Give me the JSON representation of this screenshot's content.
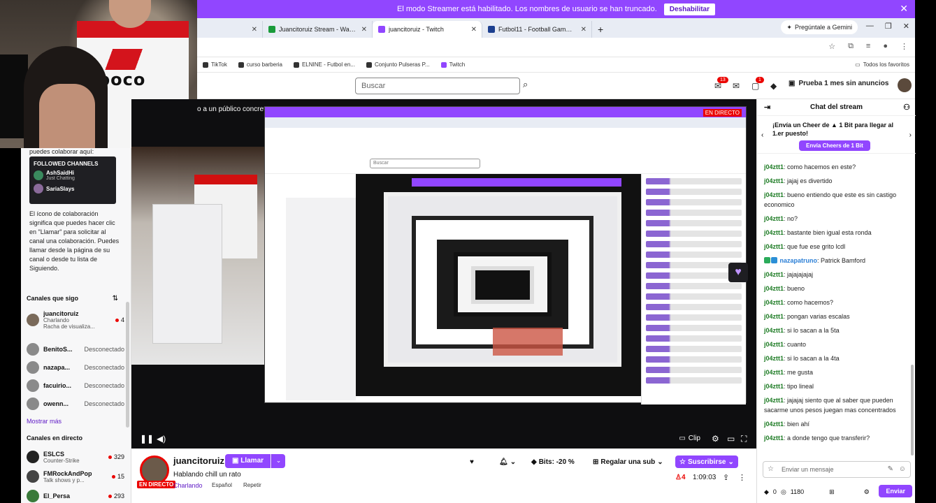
{
  "streamer_bar": {
    "message": "El modo Streamer está habilitado. Los nombres de usuario se han truncado.",
    "button": "Deshabilitar"
  },
  "tabs": [
    {
      "title": "Juancitoruiz Stream - Watch Li...",
      "color": "#1a9b3a"
    },
    {
      "title": "juancitoruiz - Twitch",
      "color": "#9146ff"
    },
    {
      "title": "Futbol11 - Football Games Daily",
      "color": "#1c3f8f"
    }
  ],
  "gemini": "Pregúntale a Gemini",
  "bookmarks": [
    {
      "label": "TikTok"
    },
    {
      "label": "curso barberia"
    },
    {
      "label": "ELNINE - Futbol en..."
    },
    {
      "label": "Conjunto Pulseras P..."
    },
    {
      "label": "Twitch"
    }
  ],
  "bookmarks_folder": "Todos los favoritos",
  "header": {
    "search_placeholder": "Buscar",
    "notif_badge_1": "13",
    "notif_badge_2": "1",
    "prime": "Prueba 1 mes sin anuncios"
  },
  "sidebar": {
    "cut_text": "puedes colaborar aquí:",
    "collab_card": {
      "title": "FOLLOWED CHANNELS",
      "rows": [
        {
          "name": "AshSaidHi",
          "status": "Just Chatting"
        },
        {
          "name": "SariaSlays",
          "status": ""
        }
      ]
    },
    "collab_text": "El ícono de colaboración significa que puedes hacer clic en \"Llamar\" para solicitar al canal una colaboración. Puedes llamar desde la página de su canal o desde tu lista de Siguiendo.",
    "followed_title": "Canales que sigo",
    "followed": [
      {
        "name": "juancitoruiz",
        "category": "Charlando",
        "extra": "Racha de visualiza...",
        "viewers": "4",
        "live": true
      },
      {
        "name": "BenitoS...",
        "status": "Desconectado",
        "live": false
      },
      {
        "name": "nazapa...",
        "status": "Desconectado",
        "live": false
      },
      {
        "name": "facuirio...",
        "status": "Desconectado",
        "live": false
      },
      {
        "name": "owenn...",
        "status": "Desconectado",
        "live": false
      }
    ],
    "show_more": "Mostrar más",
    "live_title": "Canales en directo",
    "live_channels": [
      {
        "name": "ESLCS",
        "category": "Counter-Strike",
        "viewers": "329"
      },
      {
        "name": "FMRockAndPop",
        "category": "Talk shows y p...",
        "viewers": "15"
      },
      {
        "name": "El_Persa",
        "category": "",
        "viewers": "293"
      }
    ]
  },
  "video": {
    "audience_text": "o a un público concreto.",
    "nested_live": "EN DIRECTO",
    "nested_search": "Buscar",
    "clip": "Clip"
  },
  "stream_info": {
    "streamer": "juancitoruiz",
    "live_tag": "EN DIRECTO",
    "title": "Hablando chill un rato",
    "category": "Charlando",
    "tags": [
      "Español",
      "Repetir"
    ],
    "call_button": "Llamar",
    "bits": "Bits: -20 %",
    "gift": "Regalar una sub",
    "subscribe": "Suscribirse",
    "viewers": "4",
    "uptime": "1:09:03"
  },
  "chat": {
    "title": "Chat del stream",
    "cheer_text": "¡Envía un Cheer de ▲ 1 Bit para llegar al 1.er puesto!",
    "cheer_button": "Envía Cheers de 1 Bit",
    "messages": [
      {
        "user": "j04ztt1",
        "text": "como hacemos en este?"
      },
      {
        "user": "j04ztt1",
        "text": "jajaj es divertido"
      },
      {
        "user": "j04ztt1",
        "text": "bueno entiendo que este es sin castigo economico"
      },
      {
        "user": "j04ztt1",
        "text": "no?"
      },
      {
        "user": "j04ztt1",
        "text": "bastante bien igual esta ronda"
      },
      {
        "user": "j04ztt1",
        "text": "que fue ese grito lcdl"
      },
      {
        "user": "nazapatruno",
        "text": "Patrick Bamford",
        "badged": true
      },
      {
        "user": "j04ztt1",
        "text": "jajajajajaj"
      },
      {
        "user": "j04ztt1",
        "text": "bueno"
      },
      {
        "user": "j04ztt1",
        "text": "como hacemos?"
      },
      {
        "user": "j04ztt1",
        "text": "pongan varias escalas"
      },
      {
        "user": "j04ztt1",
        "text": "si lo sacan a la 5ta"
      },
      {
        "user": "j04ztt1",
        "text": "cuanto"
      },
      {
        "user": "j04ztt1",
        "text": "si lo sacan a la 4ta"
      },
      {
        "user": "j04ztt1",
        "text": "me gusta"
      },
      {
        "user": "j04ztt1",
        "text": "tipo lineal"
      },
      {
        "user": "j04ztt1",
        "text": "jajajaj siento que al saber que pueden sacarme unos pesos juegan mas concentrados"
      },
      {
        "user": "j04ztt1",
        "text": "bien ahí"
      },
      {
        "user": "j04ztt1",
        "text": "a donde tengo que transferir?"
      }
    ],
    "input_placeholder": "Enviar un mensaje",
    "bits_count": "0",
    "points": "1180",
    "send": "Enviar"
  },
  "webcam": {
    "shirt_text": "boco"
  }
}
